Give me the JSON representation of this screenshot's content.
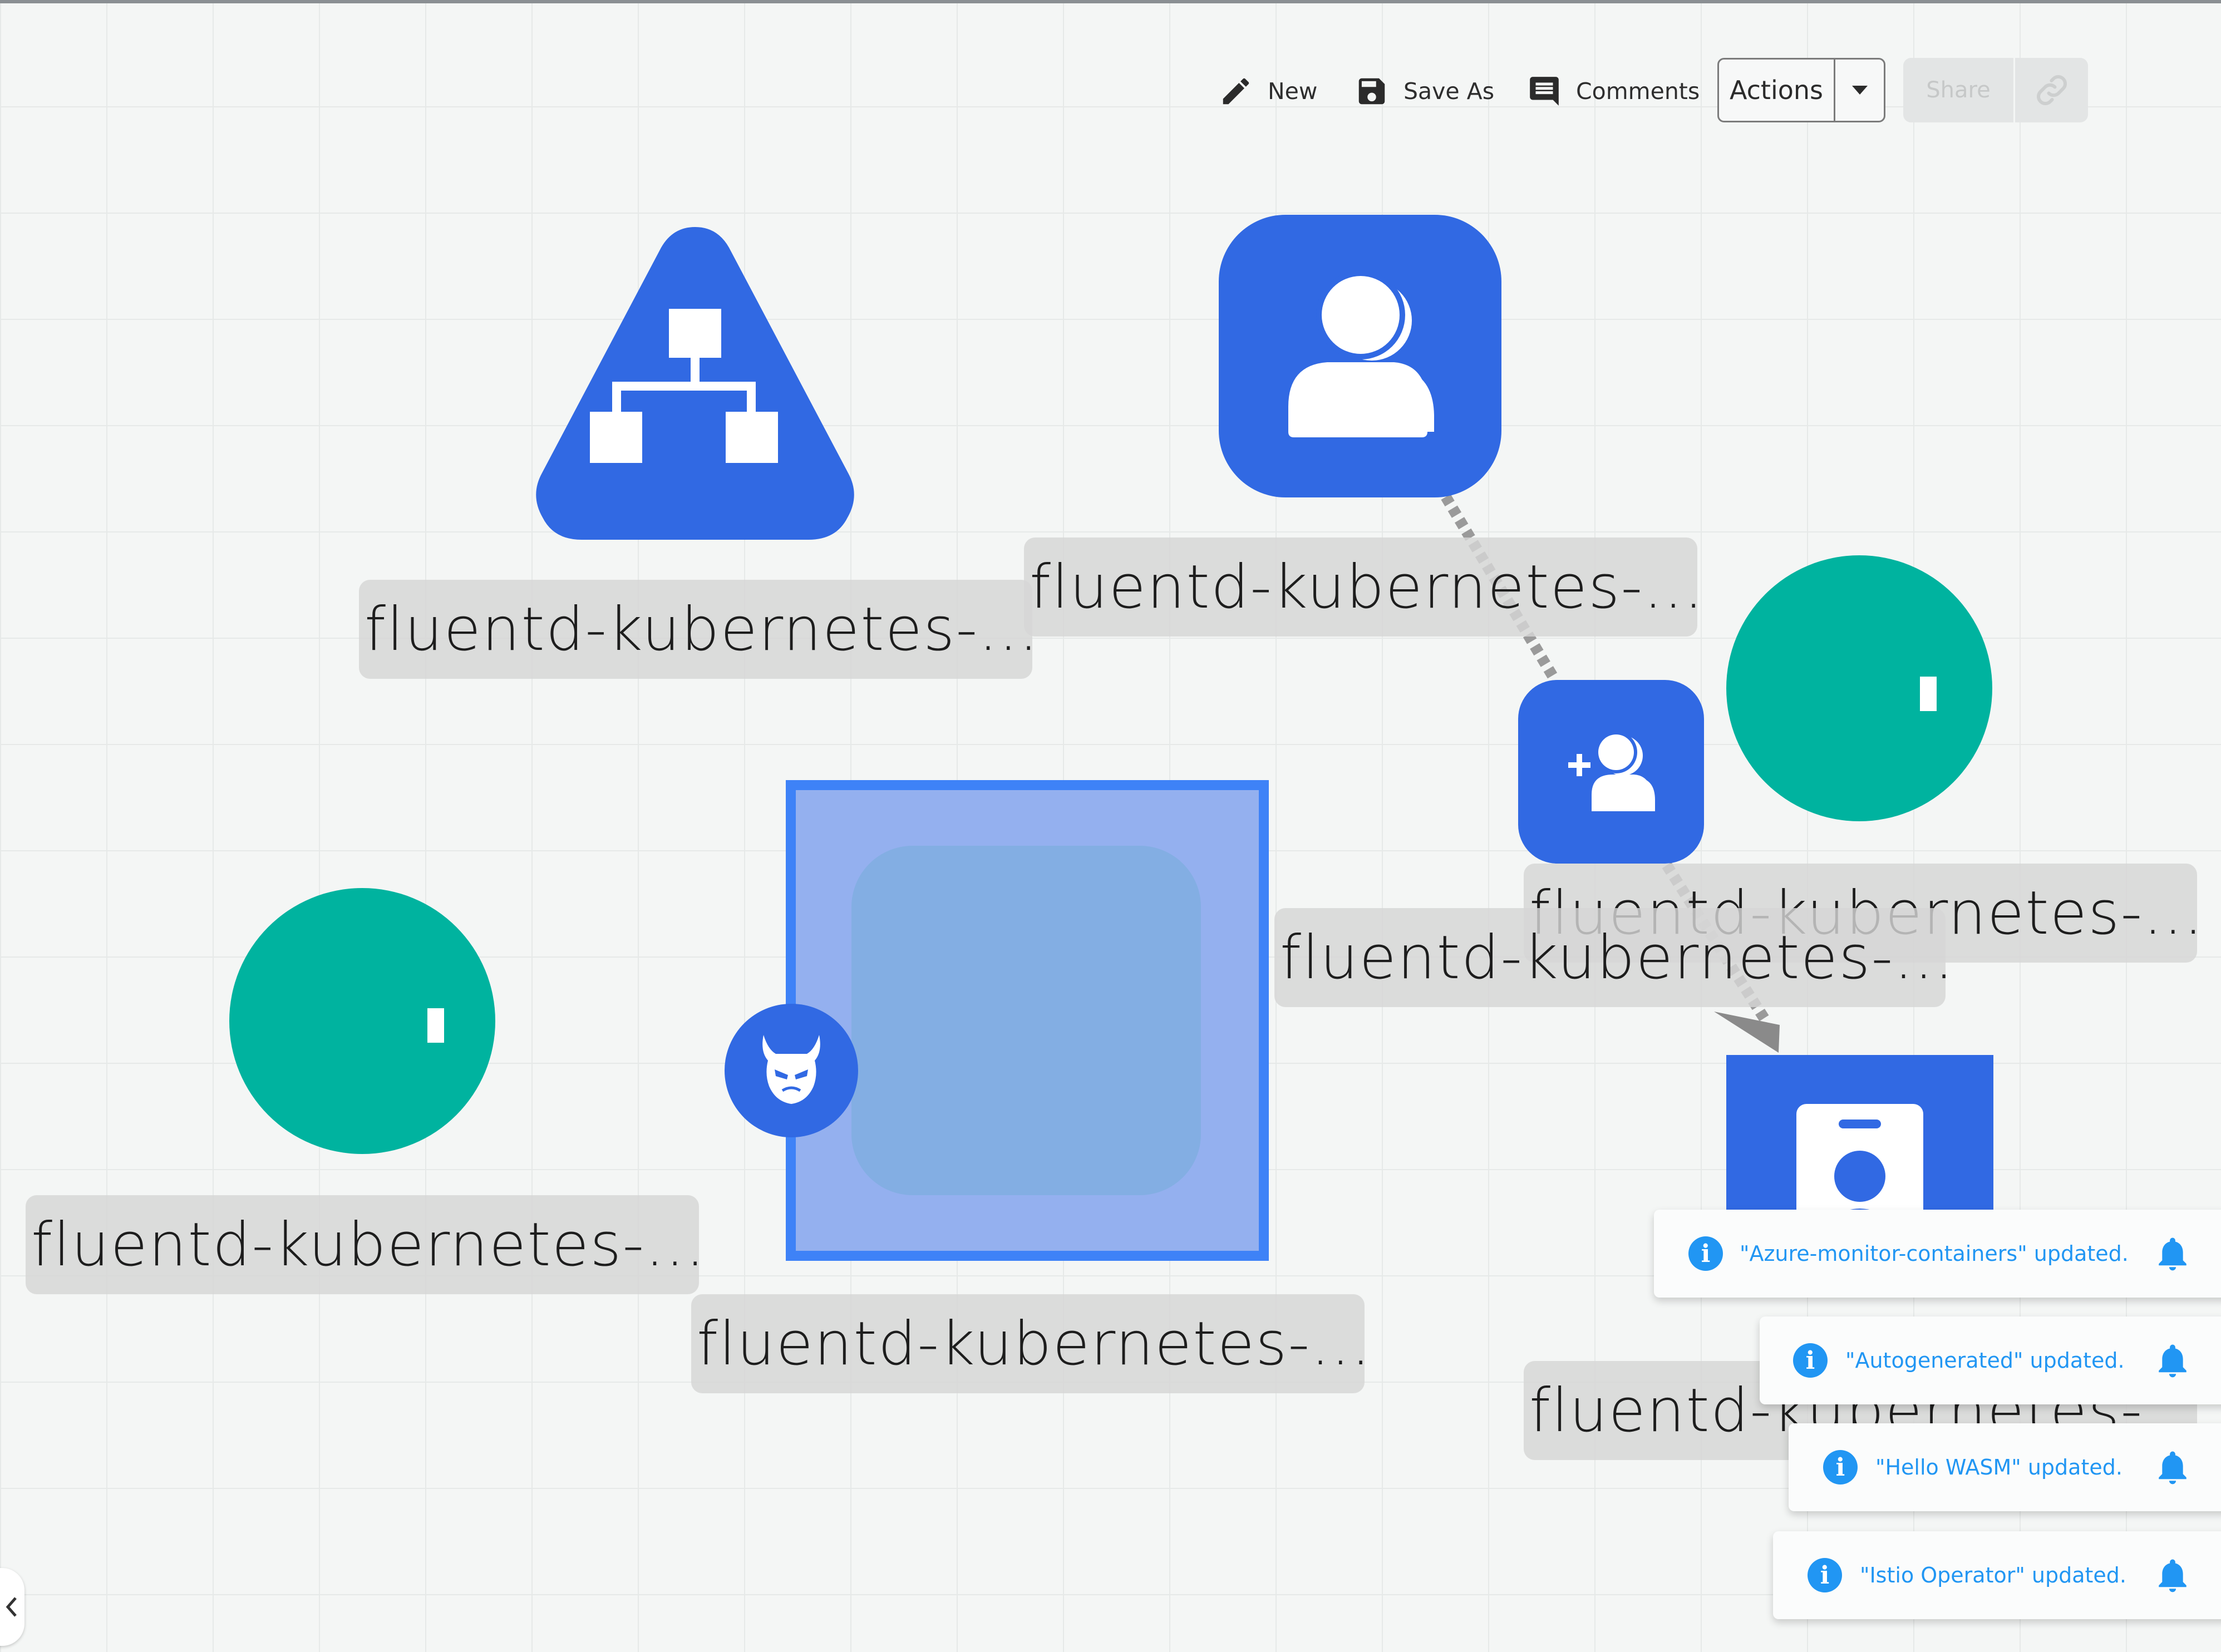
{
  "toolbar": {
    "new_label": "New",
    "save_as_label": "Save As",
    "comments_label": "Comments",
    "actions_label": "Actions",
    "share_label": "Share"
  },
  "nodes": [
    {
      "label": "fluentd-kubernetes-...",
      "icon": "hierarchy-icon",
      "shape": "triangle"
    },
    {
      "label": "fluentd-kubernetes-...",
      "icon": "users-icon",
      "shape": "rounded-square"
    },
    {
      "label": "fluentd-kubernetes-...",
      "icon": "add-user-icon",
      "shape": "rounded-square"
    },
    {
      "label": "fluentd-kubernetes-...",
      "icon": "",
      "shape": "circle"
    },
    {
      "label": "fluentd-kubernetes-...",
      "icon": "",
      "shape": "circle"
    },
    {
      "label": "fluentd-kubernetes-...",
      "icon": "devil-icon",
      "shape": "square-selected"
    },
    {
      "label": "fluentd-kubernetes-...",
      "icon": "",
      "shape": "rounded-square"
    },
    {
      "label": "fluentd-kubernetes-",
      "icon": "id-badge-icon",
      "shape": "square"
    }
  ],
  "notifications": [
    {
      "message": "\"Azure-monitor-containers\" updated."
    },
    {
      "message": "\"Autogenerated\" updated."
    },
    {
      "message": "\"Hello WASM\" updated."
    },
    {
      "message": "\"Istio Operator\" updated."
    }
  ],
  "colors": {
    "node_blue": "#3169e3",
    "node_teal": "#00b39f",
    "selection_blue": "#3e82f7",
    "notification_blue": "#2196f3"
  }
}
